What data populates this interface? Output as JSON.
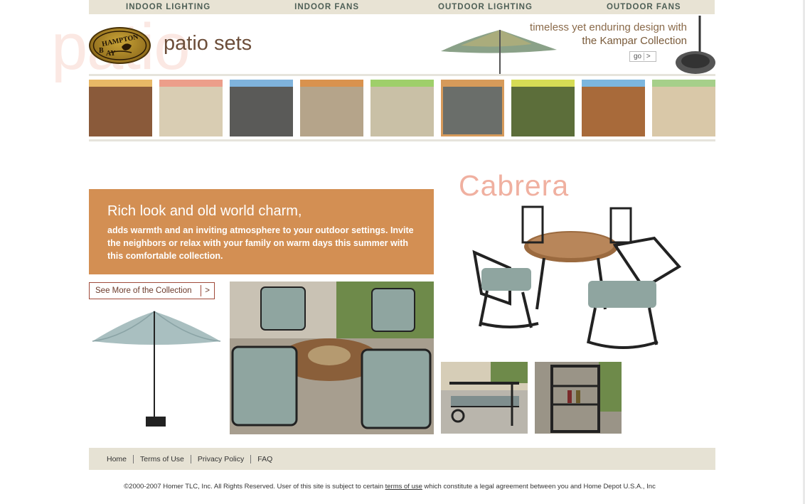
{
  "topnav": [
    "INDOOR LIGHTING",
    "INDOOR FANS",
    "OUTDOOR LIGHTING",
    "OUTDOOR FANS"
  ],
  "brand": {
    "logo_text": "HAMPTON BAY"
  },
  "watermark": "patio",
  "page_title": "patio sets",
  "promo": {
    "line1": "timeless yet enduring design with",
    "line2": "the Kampar Collection",
    "go_label": "go",
    "go_arrow": ">"
  },
  "thumbs": [
    {
      "band": "#e8b866",
      "photo": "#8a5a3a"
    },
    {
      "band": "#ec9e8a",
      "photo": "#d9cdb3"
    },
    {
      "band": "#7fb3dc",
      "photo": "#5a5a58"
    },
    {
      "band": "#d9924e",
      "photo": "#b5a48a"
    },
    {
      "band": "#9fcf6a",
      "photo": "#c9c0a6"
    },
    {
      "band": "#d69a5a",
      "photo": "#6a6e6a",
      "selected": true
    },
    {
      "band": "#d6dc55",
      "photo": "#5c6e3a"
    },
    {
      "band": "#7cb6de",
      "photo": "#a86a3a"
    },
    {
      "band": "#a6cf8a",
      "photo": "#d9c8a8"
    }
  ],
  "banner": {
    "heading": "Rich look and old world charm,",
    "body": "adds warmth and an inviting atmosphere to your outdoor settings. Invite the neighbors or relax with your family on warm days this summer with this comfortable collection."
  },
  "see_more": {
    "label": "See More of the Collection",
    "arrow": ">"
  },
  "collection_name": "Cabrera",
  "footer": {
    "links": [
      "Home",
      "Terms of Use",
      "Privacy Policy",
      "FAQ"
    ]
  },
  "copyright": {
    "before": "©2000-2007 Homer TLC, Inc. All Rights Reserved. User of this site is subject to certain ",
    "link": "terms of use",
    "after": " which constitute a legal agreement between you and Home Depot U.S.A., Inc"
  },
  "colors": {
    "nav_bg": "#e8e3d4",
    "banner": "#d38f53",
    "accent_title": "#f0b0a0",
    "watermark": "#fbe8e3"
  }
}
